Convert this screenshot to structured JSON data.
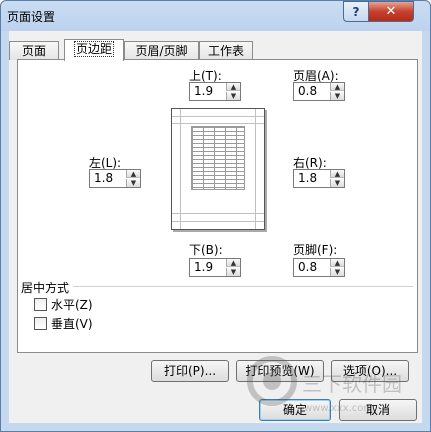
{
  "window": {
    "title": "页面设置",
    "help_label": "?",
    "close_label": "✕"
  },
  "tabs": [
    {
      "label": "页面",
      "active": false
    },
    {
      "label": "页边距",
      "active": true
    },
    {
      "label": "页眉/页脚",
      "active": false
    },
    {
      "label": "工作表",
      "active": false
    }
  ],
  "margins": {
    "top": {
      "label": "上(T):",
      "value": "1.9"
    },
    "header": {
      "label": "页眉(A):",
      "value": "0.8"
    },
    "left": {
      "label": "左(L):",
      "value": "1.8"
    },
    "right": {
      "label": "右(R):",
      "value": "1.8"
    },
    "bottom": {
      "label": "下(B):",
      "value": "1.9"
    },
    "footer": {
      "label": "页脚(F):",
      "value": "0.8"
    }
  },
  "centering": {
    "title": "居中方式",
    "horizontal": {
      "label": "水平(Z)",
      "checked": false
    },
    "vertical": {
      "label": "垂直(V)",
      "checked": false
    }
  },
  "buttons": {
    "print": "打印(P)...",
    "print_preview": "打印预览(W)",
    "options": "选项(O)...",
    "ok": "确定",
    "cancel": "取消"
  },
  "watermark": {
    "text": "三下软件园",
    "url": "www.xxx.com"
  },
  "colors": {
    "title_bar": "#bcd2ee",
    "close_button": "#c6412e",
    "panel": "#ffffff",
    "dialog_bg": "#f0f0f0"
  }
}
